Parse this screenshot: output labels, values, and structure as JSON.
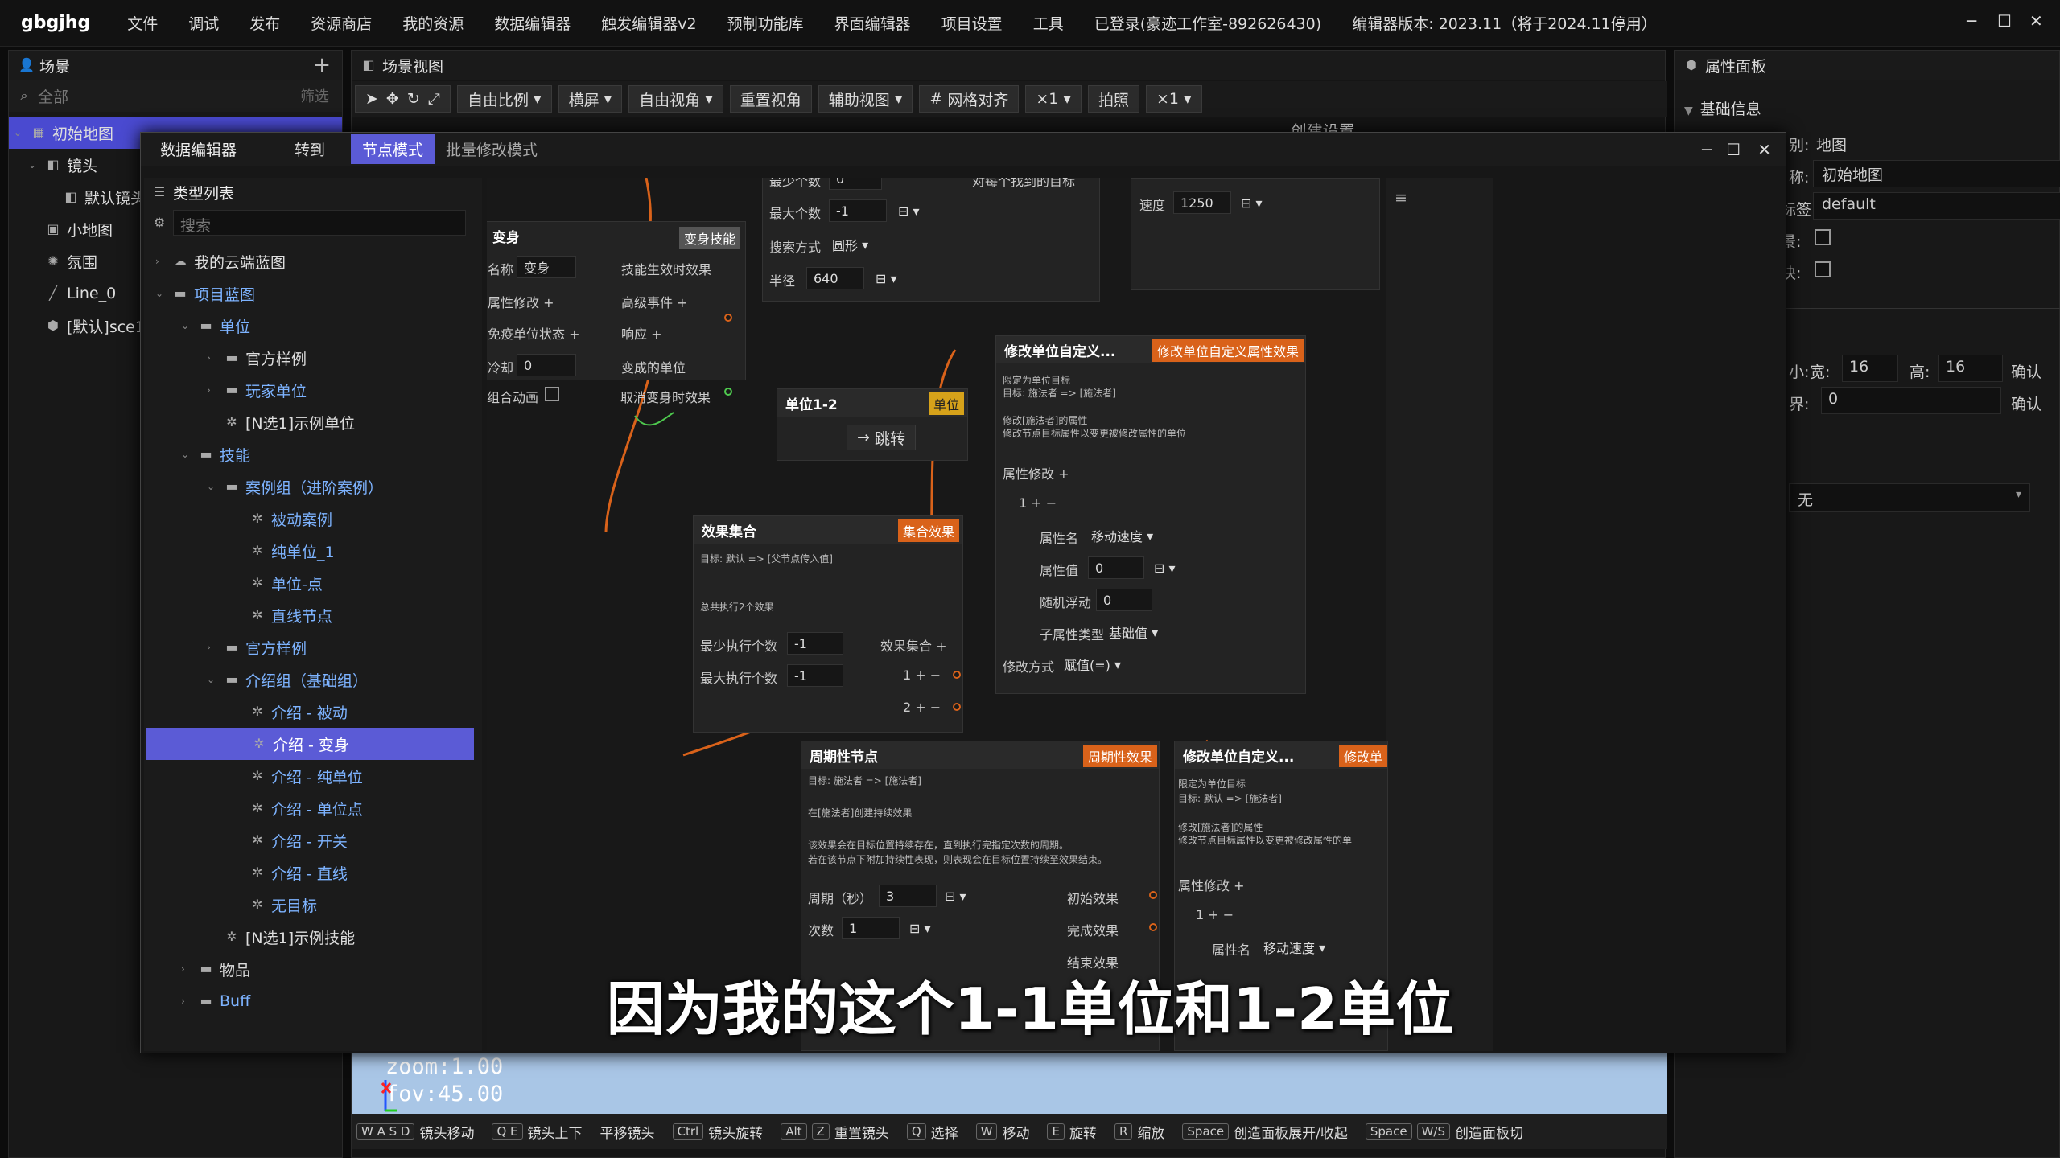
{
  "menubar": {
    "logo": "gbgjhg",
    "items": [
      "文件",
      "调试",
      "发布",
      "资源商店",
      "我的资源",
      "数据编辑器",
      "触发编辑器v2",
      "预制功能库",
      "界面编辑器",
      "项目设置",
      "工具"
    ],
    "login": "已登录(豪迹工作室-892626430)",
    "version": "编辑器版本: 2023.11（将于2024.11停用）"
  },
  "scene_panel": {
    "title": "场景",
    "search_placeholder": "全部",
    "filter": "筛选",
    "tree": [
      "初始地图",
      "镜头",
      "默认镜头",
      "小地图",
      "氛围",
      "Line_0",
      "[默认]sce1"
    ]
  },
  "scene_view": {
    "title": "场景视图",
    "toolbar": [
      "自由比例",
      "横屏",
      "自由视角",
      "重置视角",
      "辅助视图",
      "网格对齐",
      "×1",
      "拍照",
      "×1"
    ],
    "create_settings": "创建设置",
    "zoom": "zoom:1.00",
    "fov": "fov:45.00"
  },
  "props_panel": {
    "title": "属性面板",
    "section": "基础信息",
    "type_label": "别:",
    "type_value": "地图",
    "name_label": "称:",
    "name_value": "初始地图",
    "tag_label": "标签:",
    "tag_value": "default",
    "check1": "景:",
    "check2": "块:",
    "size_label": "小:",
    "width_label": "宽:",
    "width_value": "16",
    "height_label": "高:",
    "height_value": "16",
    "confirm": "确认",
    "border_label": "界:",
    "border_value": "0",
    "confirm2": "确认",
    "select_value": "无"
  },
  "data_editor": {
    "title": "数据编辑器",
    "goto": "转到",
    "tab_node": "节点模式",
    "tab_batch": "批量修改模式",
    "type_list": "类型列表",
    "search_placeholder": "搜索",
    "tree": [
      {
        "label": "我的云端蓝图",
        "indent": 0,
        "arrow": "›"
      },
      {
        "label": "项目蓝图",
        "indent": 0,
        "arrow": "⌄",
        "color": "#7db3ff"
      },
      {
        "label": "单位",
        "indent": 1,
        "arrow": "⌄",
        "color": "#7db3ff"
      },
      {
        "label": "官方样例",
        "indent": 2,
        "arrow": "›"
      },
      {
        "label": "玩家单位",
        "indent": 2,
        "arrow": "›",
        "color": "#7db3ff"
      },
      {
        "label": "[N选1]示例单位",
        "indent": 2,
        "arrow": ""
      },
      {
        "label": "技能",
        "indent": 1,
        "arrow": "⌄",
        "color": "#7db3ff"
      },
      {
        "label": "案例组（进阶案例）",
        "indent": 2,
        "arrow": "⌄",
        "color": "#7db3ff"
      },
      {
        "label": "被动案例",
        "indent": 3,
        "arrow": "",
        "color": "#7db3ff"
      },
      {
        "label": "纯单位_1",
        "indent": 3,
        "arrow": "",
        "color": "#7db3ff"
      },
      {
        "label": "单位-点",
        "indent": 3,
        "arrow": "",
        "color": "#7db3ff"
      },
      {
        "label": "直线节点",
        "indent": 3,
        "arrow": "",
        "color": "#7db3ff"
      },
      {
        "label": "官方样例",
        "indent": 2,
        "arrow": "›",
        "color": "#7db3ff"
      },
      {
        "label": "介绍组（基础组）",
        "indent": 2,
        "arrow": "⌄",
        "color": "#7db3ff"
      },
      {
        "label": "介绍 - 被动",
        "indent": 3,
        "arrow": "",
        "color": "#7db3ff"
      },
      {
        "label": "介绍 - 变身",
        "indent": 3,
        "arrow": "",
        "selected": true
      },
      {
        "label": "介绍 - 纯单位",
        "indent": 3,
        "arrow": "",
        "color": "#7db3ff"
      },
      {
        "label": "介绍 - 单位点",
        "indent": 3,
        "arrow": "",
        "color": "#7db3ff"
      },
      {
        "label": "介绍 - 开关",
        "indent": 3,
        "arrow": "",
        "color": "#7db3ff"
      },
      {
        "label": "介绍 - 直线",
        "indent": 3,
        "arrow": "",
        "color": "#7db3ff"
      },
      {
        "label": "无目标",
        "indent": 3,
        "arrow": "",
        "color": "#7db3ff"
      },
      {
        "label": "[N选1]示例技能",
        "indent": 2,
        "arrow": ""
      },
      {
        "label": "物品",
        "indent": 1,
        "arrow": "›"
      },
      {
        "label": "Buff",
        "indent": 1,
        "arrow": "›",
        "color": "#7db3ff"
      }
    ]
  },
  "nodes": {
    "transform": {
      "title": "变身",
      "tag": "变身技能",
      "name_label": "名称",
      "name_value": "变身",
      "attr_mod": "属性修改",
      "immune": "免疫单位状态",
      "cooldown_label": "冷却",
      "cooldown_value": "0",
      "anim_label": "组合动画",
      "effect_on": "技能生效时效果",
      "advanced": "高级事件",
      "respond": "响应",
      "changed_unit": "变成的单位",
      "cancel_effect": "取消变身时效果"
    },
    "search": {
      "min_count_label": "最少个数",
      "min_count": "0",
      "max_count_label": "最大个数",
      "max_count": "-1",
      "mode_label": "搜索方式",
      "mode_value": "圆形",
      "radius_label": "半径",
      "radius_value": "640",
      "each_target": "对每个找到的目标"
    },
    "speed": {
      "label": "速度",
      "value": "1250"
    },
    "unit12": {
      "title": "单位1-2",
      "tag": "单位",
      "jump": "跳转"
    },
    "effect_set": {
      "title": "效果集合",
      "tag": "集合效果",
      "desc1": "目标: 默认 => [父节点传入值]",
      "desc2": "总共执行2个效果",
      "min_exec_label": "最少执行个数",
      "min_exec": "-1",
      "max_exec_label": "最大执行个数",
      "max_exec": "-1",
      "set_label": "效果集合",
      "item1": "1",
      "item2": "2"
    },
    "modify_unit": {
      "title": "修改单位自定义...",
      "tag": "修改单位自定义属性效果",
      "desc1": "限定为单位目标",
      "desc2": "目标: 施法者 => [施法者]",
      "desc3": "修改[施法者]的属性",
      "desc4": "修改节点目标属性以变更被修改属性的单位",
      "attr_mod": "属性修改",
      "idx": "1",
      "attr_name_label": "属性名",
      "attr_name": "移动速度",
      "attr_val_label": "属性值",
      "attr_val": "0",
      "rand_label": "随机浮动",
      "rand_val": "0",
      "sub_type_label": "子属性类型",
      "sub_type": "基础值",
      "mod_way_label": "修改方式",
      "mod_way": "赋值(=)"
    },
    "periodic": {
      "title": "周期性节点",
      "tag": "周期性效果",
      "desc1": "目标: 施法者 => [施法者]",
      "desc2": "在[施法者]创建持续效果",
      "desc3": "该效果会在目标位置持续存在，直到执行完指定次数的周期。",
      "desc4": "若在该节点下附加持续性表现，则表现会在目标位置持续至效果结束。",
      "period_label": "周期（秒）",
      "period": "3",
      "count_label": "次数",
      "count": "1",
      "init_effect": "初始效果",
      "done_effect": "完成效果",
      "end_effect": "结束效果"
    },
    "modify_unit2": {
      "title": "修改单位自定义...",
      "tag": "修改单",
      "desc1": "限定为单位目标",
      "desc2": "目标: 默认 => [施法者]",
      "desc3": "修改[施法者]的属性",
      "desc4": "修改节点目标属性以变更被修改属性的单",
      "attr_mod": "属性修改",
      "idx": "1",
      "attr_name_label": "属性名",
      "attr_name": "移动速度"
    }
  },
  "subtitle": "因为我的这个1-1单位和1-2单位",
  "shortcuts": [
    {
      "keys": [
        "W A S D"
      ],
      "label": "镜头移动"
    },
    {
      "keys": [
        "Q E"
      ],
      "label": "镜头上下"
    },
    {
      "keys": [],
      "label": "平移镜头"
    },
    {
      "keys": [
        "Ctrl"
      ],
      "label": "镜头旋转"
    },
    {
      "keys": [
        "Alt",
        "Z"
      ],
      "label": "重置镜头"
    },
    {
      "keys": [
        "Q"
      ],
      "label": "选择"
    },
    {
      "keys": [
        "W"
      ],
      "label": "移动"
    },
    {
      "keys": [
        "E"
      ],
      "label": "旋转"
    },
    {
      "keys": [
        "R"
      ],
      "label": "缩放"
    },
    {
      "keys": [
        "Space"
      ],
      "label": "创造面板展开/收起"
    },
    {
      "keys": [
        "Space",
        "W/S"
      ],
      "label": "创造面板切"
    }
  ],
  "colors": {
    "accent": "#5b5bd6",
    "orange": "#d9621a",
    "green": "#4ec94e",
    "viewport": "#a9c6e6"
  }
}
